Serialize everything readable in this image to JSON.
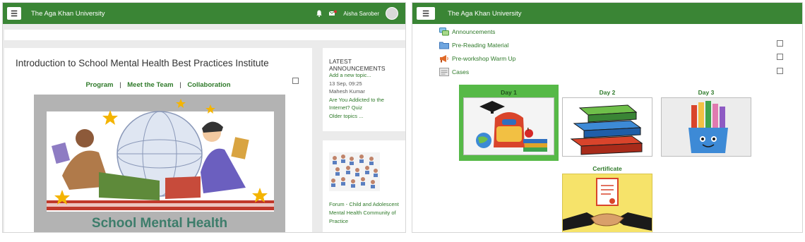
{
  "left": {
    "brand": "The Aga Khan University",
    "user_name": "Aisha Sarober",
    "course_title": "Introduction to School Mental Health Best Practices Institute",
    "links": [
      "Program",
      "Meet the Team",
      "Collaboration"
    ],
    "link_separator": "|",
    "banner_title": "School Mental Health",
    "announcements": {
      "heading": "LATEST ANNOUNCEMENTS",
      "add_topic": "Add a new topic...",
      "date": "13 Sep, 09:25",
      "author": "Mahesh Kumar",
      "post_title_line1": "Are You Addicted to the",
      "post_title_line2": "Internet? Quiz",
      "older": "Older topics ..."
    },
    "forum": {
      "line1": "Forum - Child and Adolescent",
      "line2": "Mental Health Community of",
      "line3": "Practice"
    }
  },
  "right": {
    "brand": "The Aga Khan University",
    "activities": [
      {
        "label": "Announcements",
        "icon": "forum-icon"
      },
      {
        "label": "Pre-Reading Material",
        "icon": "folder-icon"
      },
      {
        "label": "Pre-workshop Warm Up",
        "icon": "megaphone-icon"
      },
      {
        "label": "Cases",
        "icon": "document-icon"
      }
    ],
    "days": [
      "Day 1",
      "Day 2",
      "Day 3"
    ],
    "certificate": "Certificate"
  },
  "colors": {
    "brand_green": "#3a8535",
    "link_green": "#2f7a2a",
    "selected_tile": "#56b947"
  }
}
